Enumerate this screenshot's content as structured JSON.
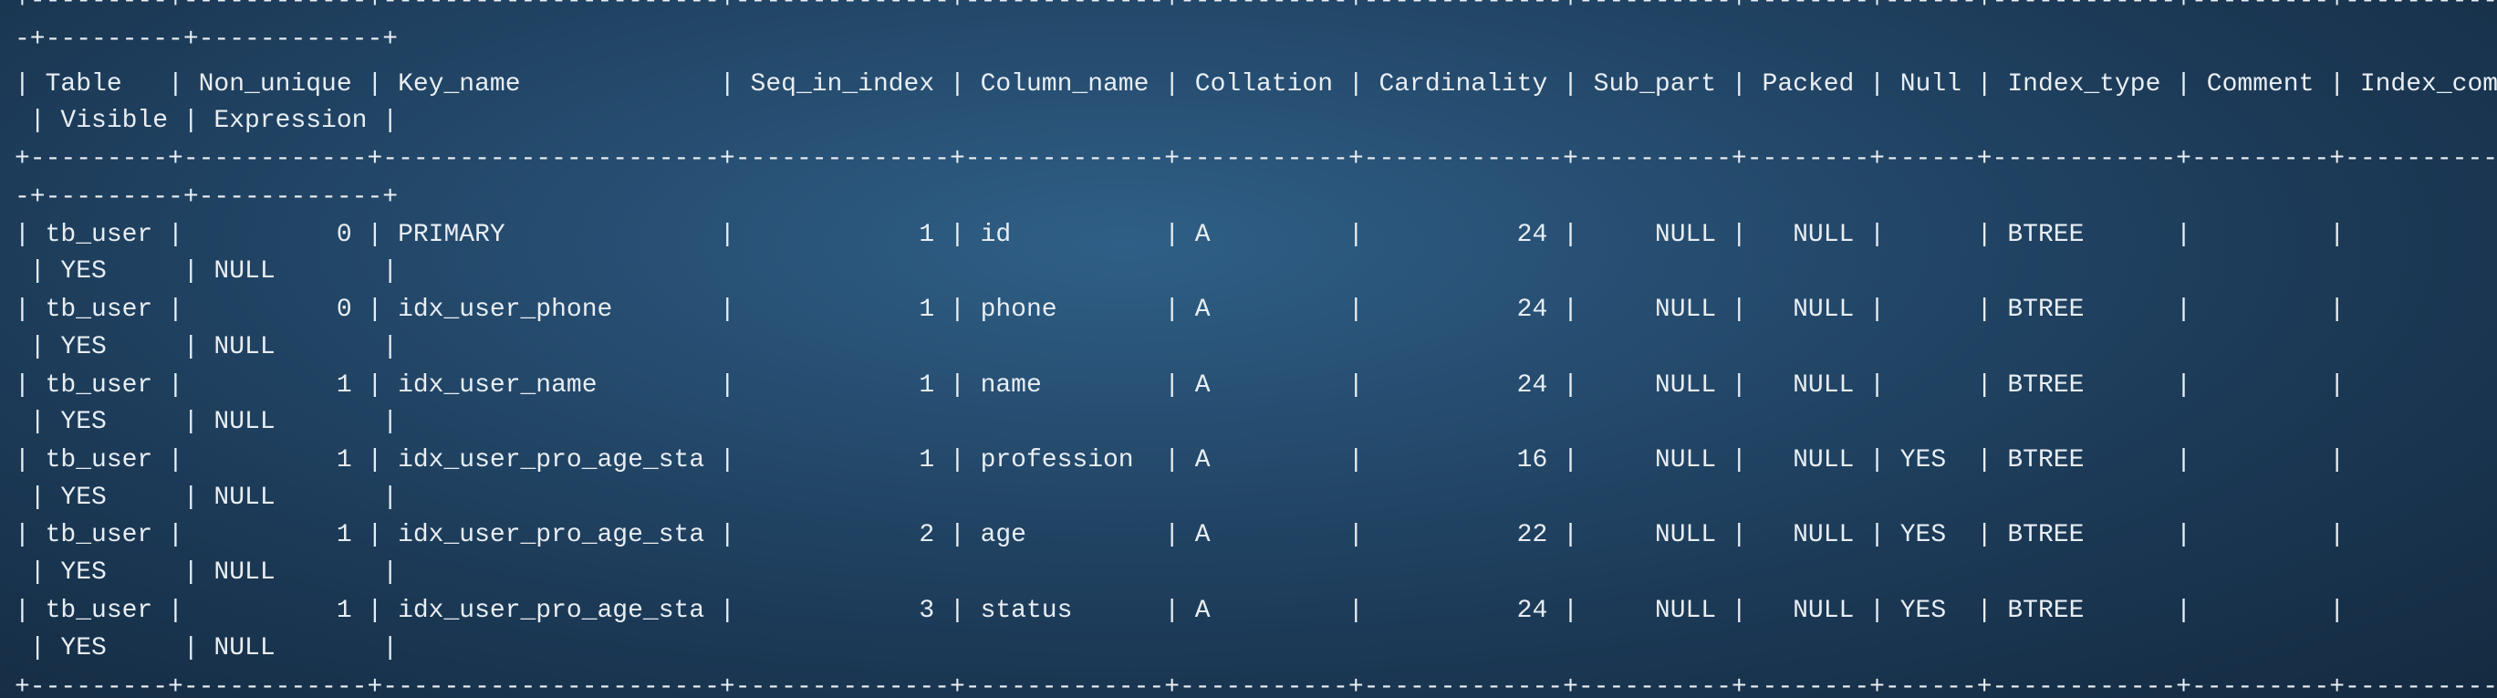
{
  "terminal": {
    "lines": [
      "+---------+------------+----------------------+--------------+-------------+-----------+-------------+----------+--------+------+------------+---------+---------------+",
      "-+---------+------------+",
      "| Table   | Non_unique | Key_name             | Seq_in_index | Column_name | Collation | Cardinality | Sub_part | Packed | Null | Index_type | Comment | Index_comment",
      " | Visible | Expression |",
      "+---------+------------+----------------------+--------------+-------------+-----------+-------------+----------+--------+------+------------+---------+---------------+",
      "-+---------+------------+",
      "| tb_user |          0 | PRIMARY              |            1 | id          | A         |          24 |     NULL |   NULL |      | BTREE      |         |",
      " | YES     | NULL       |",
      "| tb_user |          0 | idx_user_phone       |            1 | phone       | A         |          24 |     NULL |   NULL |      | BTREE      |         |",
      " | YES     | NULL       |",
      "| tb_user |          1 | idx_user_name        |            1 | name        | A         |          24 |     NULL |   NULL |      | BTREE      |         |",
      " | YES     | NULL       |",
      "| tb_user |          1 | idx_user_pro_age_sta |            1 | profession  | A         |          16 |     NULL |   NULL | YES  | BTREE      |         |",
      " | YES     | NULL       |",
      "| tb_user |          1 | idx_user_pro_age_sta |            2 | age         | A         |          22 |     NULL |   NULL | YES  | BTREE      |         |",
      " | YES     | NULL       |",
      "| tb_user |          1 | idx_user_pro_age_sta |            3 | status      | A         |          24 |     NULL |   NULL | YES  | BTREE      |         |",
      " | YES     | NULL       |",
      "+---------+------------+----------------------+--------------+-------------+-----------+-------------+----------+--------+------+------------+---------+---------------+"
    ]
  }
}
